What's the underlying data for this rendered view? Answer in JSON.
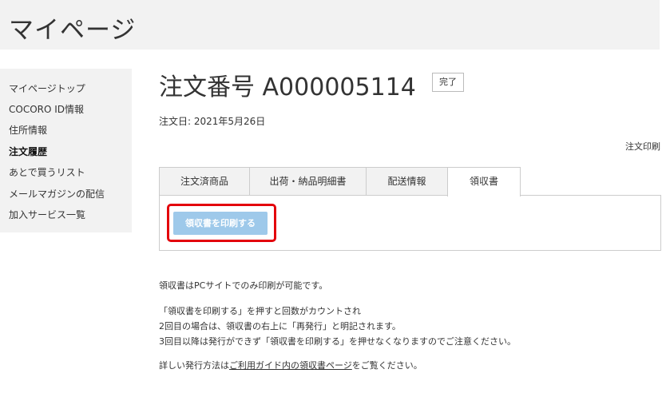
{
  "header": {
    "title": "マイページ"
  },
  "sidebar": {
    "items": [
      {
        "label": "マイページトップ"
      },
      {
        "label": "COCORO ID情報"
      },
      {
        "label": "住所情報"
      },
      {
        "label": "注文履歴"
      },
      {
        "label": "あとで買うリスト"
      },
      {
        "label": "メールマガジンの配信"
      },
      {
        "label": "加入サービス一覧"
      }
    ],
    "active_item": "注文履歴"
  },
  "order": {
    "title": "注文番号 A000005114",
    "status": "完了",
    "date": "注文日: 2021年5月26日",
    "print_label": "注文印刷"
  },
  "tabs": [
    {
      "label": "注文済商品"
    },
    {
      "label": "出荷・納品明細書"
    },
    {
      "label": "配送情報"
    },
    {
      "label": "領収書"
    }
  ],
  "active_tab": "領収書",
  "receipt": {
    "print_button": "領収書を印刷する",
    "notes": [
      "領収書はPCサイトでのみ印刷が可能です。",
      "「領収書を印刷する」を押すと回数がカウントされ",
      "2回目の場合は、領収書の右上に「再発行」と明記されます。",
      "3回目以降は発行ができず「領収書を印刷する」を押せなくなりますのでご注意ください。"
    ],
    "guide_prefix": "詳しい発行方法は",
    "guide_link": "ご利用ガイド内の領収書ページ",
    "guide_suffix": "をご覧ください。"
  },
  "colors": {
    "header_bg": "#f2f2f2",
    "button_bg": "#9ec9ea",
    "highlight": "#e3000b"
  }
}
